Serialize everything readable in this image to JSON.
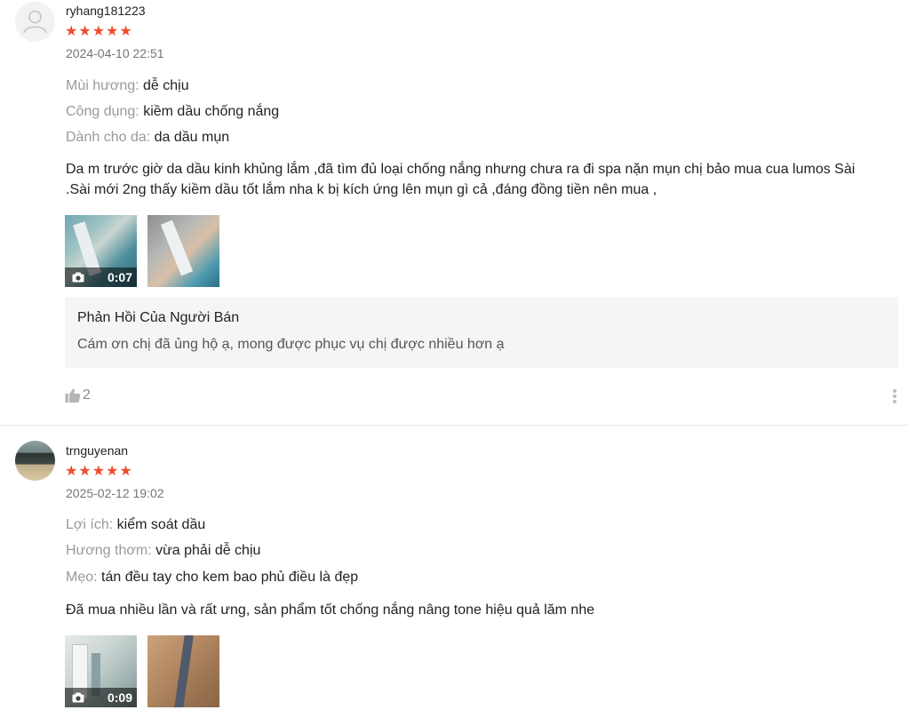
{
  "reviews": [
    {
      "username": "ryhang181223",
      "stars": "★★★★★",
      "date": "2024-04-10 22:51",
      "attributes": [
        {
          "label": "Mùi hương:",
          "value": "dễ chịu"
        },
        {
          "label": "Công dụng:",
          "value": "kiềm dầu chống nắng"
        },
        {
          "label": "Dành cho da:",
          "value": "da dầu mụn"
        }
      ],
      "comment": "Da m trước giờ da dầu kinh khủng lắm ,đã tìm đủ loại chống nắng nhưng chưa ra đi spa nặn mụn chị bảo mua cua lumos Sài .Sài mới 2ng thấy kiềm dầu tốt lắm nha k bị kích ứng lên mụn gì cả ,đáng đồng tiền nên mua ,",
      "video_duration": "0:07",
      "seller_reply": {
        "title": "Phản Hồi Của Người Bán",
        "text": "Cám ơn chị đã ủng hộ ạ, mong được phục vụ chị được nhiều hơn ạ"
      },
      "likes": "2"
    },
    {
      "username": "trnguyenan",
      "stars": "★★★★★",
      "date": "2025-02-12 19:02",
      "attributes": [
        {
          "label": "Lợi ích:",
          "value": "kiểm soát dầu"
        },
        {
          "label": "Hương thơm:",
          "value": "vừa phải dễ chịu"
        },
        {
          "label": "Mẹo:",
          "value": "tán đều tay cho kem bao phủ điều là đẹp"
        }
      ],
      "comment": "Đã mua nhiều lần và rất ưng, sản phẩm tốt chống nắng nâng tone hiệu quả lăm nhe",
      "video_duration": "0:09"
    }
  ],
  "colors": {
    "star": "#ee4d2d",
    "label_gray": "#9a9a9a",
    "reply_bg": "#f5f5f5"
  },
  "icons": [
    "user-avatar-icon",
    "camera-icon",
    "thumbs-up-icon",
    "more-vertical-icon"
  ]
}
